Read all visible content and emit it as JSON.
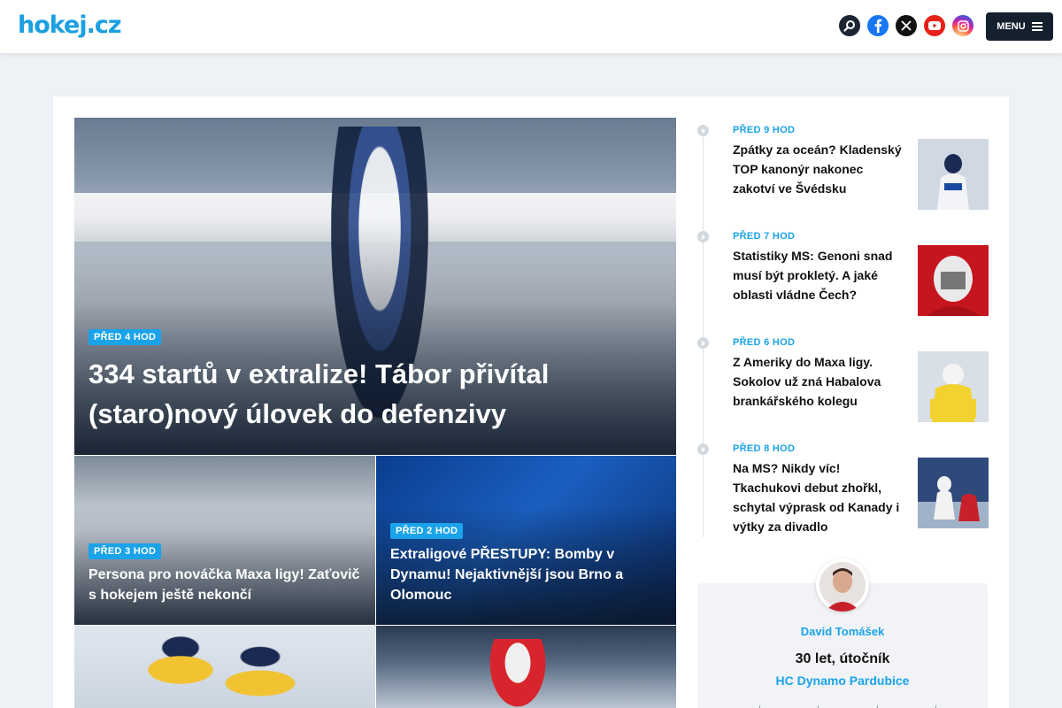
{
  "header": {
    "logo": "hokej.cz",
    "menu_label": "MENU",
    "icons": [
      "search-icon",
      "facebook-icon",
      "x-icon",
      "youtube-icon",
      "instagram-icon"
    ]
  },
  "colors": {
    "accent": "#1aa3e8",
    "dark": "#14202e"
  },
  "hero": {
    "badge": "PŘED 4 HOD",
    "title": "334 startů v extralize! Tábor přivítal (staro)nový úlovek do defenzivy"
  },
  "tiles": [
    {
      "badge": "PŘED 3 HOD",
      "title": "Persona pro nováčka Maxa ligy! Zaťovič s hokejem ještě nekončí"
    },
    {
      "badge": "PŘED 2 HOD",
      "title": "Extraligové PŘESTUPY: Bomby v Dynamu! Nejaktivnější jsou Brno a Olomouc"
    }
  ],
  "feed": [
    {
      "time": "PŘED 9 HOD",
      "title": "Zpátky za oceán? Kladenský TOP kanonýr nakonec zakotví ve Švédsku"
    },
    {
      "time": "PŘED 7 HOD",
      "title": "Statistiky MS: Genoni snad musí být prokletý. A jaké oblasti vládne Čech?"
    },
    {
      "time": "PŘED 6 HOD",
      "title": "Z Ameriky do Maxa ligy. Sokolov už zná Habalova brankářského kolegu"
    },
    {
      "time": "PŘED 8 HOD",
      "title": "Na MS? Nikdy víc! Tkachukovi debut zhořkl, schytal výprask od Kanady i výtky za divadlo"
    }
  ],
  "player": {
    "name": "David Tomášek",
    "info": "30 let, útočník",
    "team": "HC Dynamo Pardubice"
  }
}
